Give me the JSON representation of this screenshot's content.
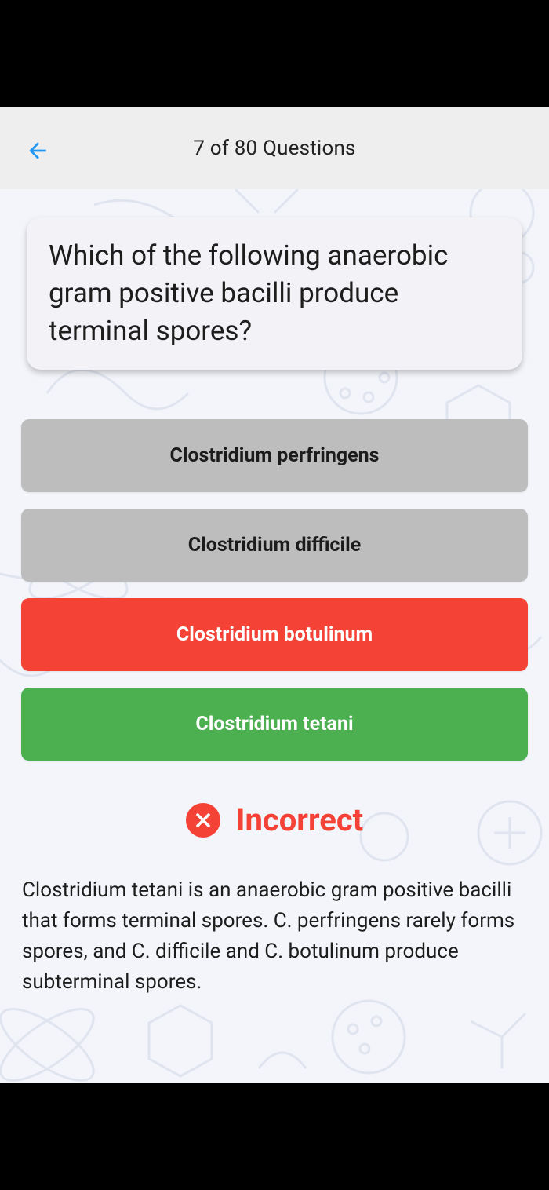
{
  "header": {
    "title": "7 of 80 Questions",
    "back_icon": "arrow-back-icon",
    "accent": "#2196f3"
  },
  "question": {
    "text": "Which of the following anaerobic gram positive bacilli produce terminal spores?"
  },
  "options": [
    {
      "label": "Clostridium perfringens",
      "state": "neutral"
    },
    {
      "label": "Clostridium difficile",
      "state": "neutral"
    },
    {
      "label": "Clostridium botulinum",
      "state": "incorrect-selected"
    },
    {
      "label": "Clostridium tetani",
      "state": "correct"
    }
  ],
  "result": {
    "label": "Incorrect",
    "icon": "close-circle-icon",
    "color": "#f44336"
  },
  "explanation": {
    "text": "Clostridium tetani is an anaerobic gram positive bacilli that forms terminal spores. C. perfringens rarely forms spores, and C. difficile and C. botulinum produce subterminal spores."
  },
  "colors": {
    "neutral": "#bdbdbd",
    "incorrect": "#f44336",
    "correct": "#4caf50"
  }
}
